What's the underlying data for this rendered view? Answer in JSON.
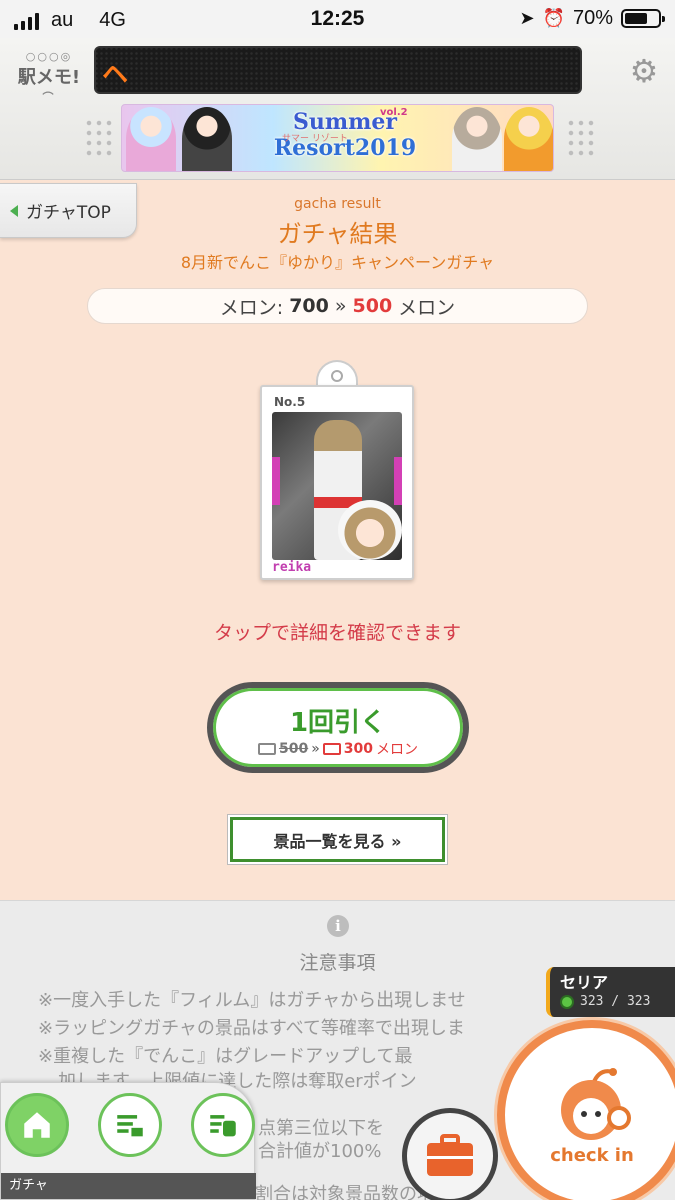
{
  "status_bar": {
    "carrier": "au",
    "network": "4G",
    "time": "12:25",
    "battery": "70%",
    "battery_level": 0.7
  },
  "header": {
    "logo_text": "駅メモ!",
    "led_text": "ヘ",
    "banner": {
      "title_line1": "Summer",
      "title_line2": "Resort2019",
      "vol": "vol.2",
      "kana": "サマー リゾート"
    }
  },
  "nav": {
    "back_label": "ガチャTOP"
  },
  "result": {
    "subtitle_en": "gacha result",
    "title": "ガチャ結果",
    "campaign": "8月新でんこ『ゆかり』キャンペーンガチャ",
    "melon_label": "メロン:",
    "melon_before": "700",
    "arrow": "»",
    "melon_after": "500",
    "melon_unit": "メロン"
  },
  "card": {
    "number": "No.5",
    "name": "reika"
  },
  "hint": "タップで詳細を確認できます",
  "draw_button": {
    "label": "1回引く",
    "old_cost": "500",
    "arrow": "»",
    "new_cost": "300",
    "unit": "メロン"
  },
  "prize_button": {
    "label": "景品一覧を見る »"
  },
  "notes": {
    "title": "注意事項",
    "lines": [
      "※一度入手した『フィルム』はガチャから出現しませ",
      "※ラッピングガチャの景品はすべて等確率で出現しま",
      "※重複した『でんこ』はグレードアップして最",
      "加します。上限値に達した際は奪取erポイン",
      "点第三位以下を",
      "合計値が100%",
      "割合は対象景品数の増減"
    ]
  },
  "character": {
    "name": "セリア",
    "hp": "323 / 323"
  },
  "bottom_nav": {
    "label": "ガチャ"
  },
  "checkin": {
    "label": "check in"
  },
  "colors": {
    "accent_orange": "#e07a20",
    "accent_green": "#3a9b2c",
    "price_red": "#e23b3b",
    "background": "#fbe3d3"
  }
}
